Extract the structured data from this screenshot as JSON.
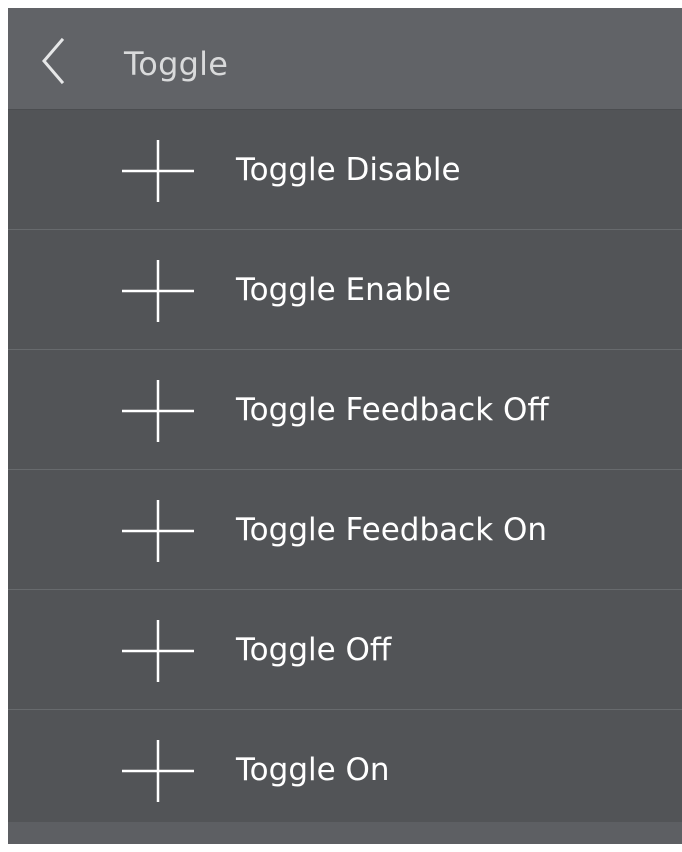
{
  "header": {
    "title": "Toggle",
    "back_icon": "chevron-left-icon"
  },
  "list": {
    "items": [
      {
        "label": "Toggle Disable",
        "icon": "plus-icon"
      },
      {
        "label": "Toggle Enable",
        "icon": "plus-icon"
      },
      {
        "label": "Toggle Feedback Off",
        "icon": "plus-icon"
      },
      {
        "label": "Toggle Feedback On",
        "icon": "plus-icon"
      },
      {
        "label": "Toggle Off",
        "icon": "plus-icon"
      },
      {
        "label": "Toggle On",
        "icon": "plus-icon"
      }
    ]
  },
  "colors": {
    "background": "#525457",
    "header": "#616367",
    "divider": "#676a6d",
    "text": "#ffffff",
    "title_text": "#d9dadb"
  }
}
